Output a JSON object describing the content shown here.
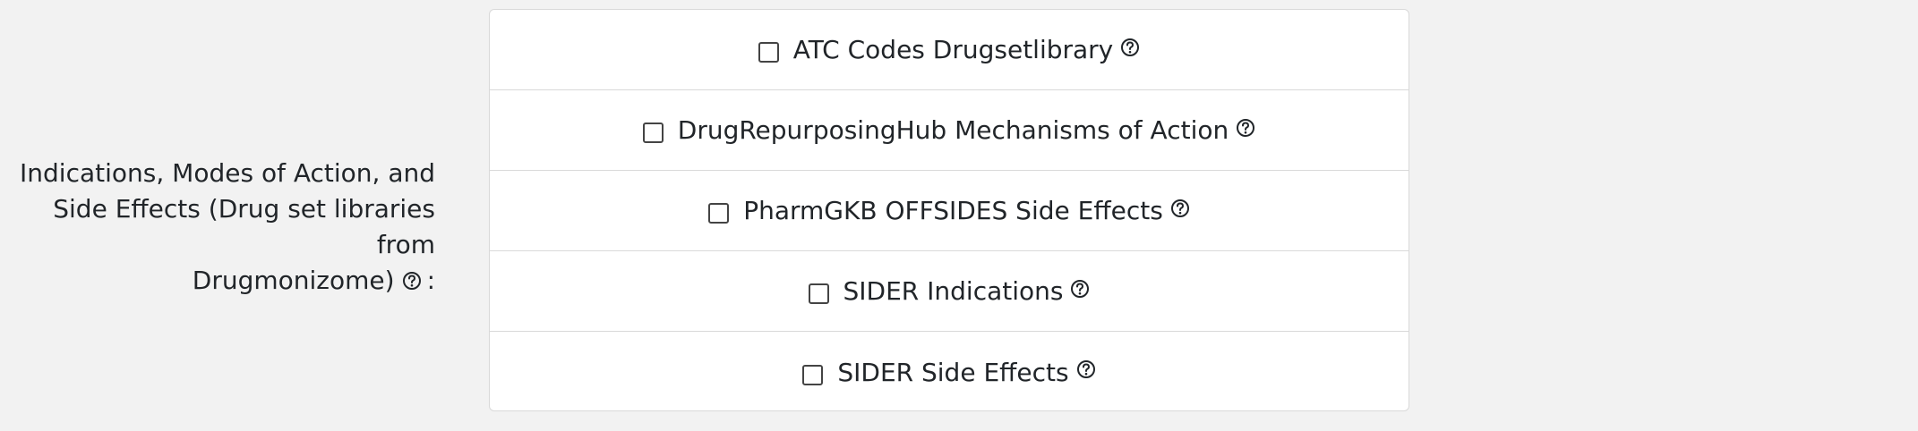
{
  "row_label": {
    "line1": "Indications, Modes of Action, and",
    "line2": "Side Effects (Drug set libraries from",
    "line3": "Drugmonizome)",
    "colon": ":",
    "icon": "question-circle-icon"
  },
  "options": [
    {
      "label": "ATC Codes Drugsetlibrary",
      "checked": false,
      "icon": "question-circle-icon"
    },
    {
      "label": "DrugRepurposingHub Mechanisms of Action",
      "checked": false,
      "icon": "question-circle-icon"
    },
    {
      "label": "PharmGKB OFFSIDES Side Effects",
      "checked": false,
      "icon": "question-circle-icon"
    },
    {
      "label": "SIDER Indications",
      "checked": false,
      "icon": "question-circle-icon"
    },
    {
      "label": "SIDER Side Effects",
      "checked": false,
      "icon": "question-circle-icon"
    }
  ],
  "colors": {
    "background": "#f2f2f2",
    "panel": "#ffffff",
    "border": "#d9d9d9",
    "text": "#212529"
  }
}
